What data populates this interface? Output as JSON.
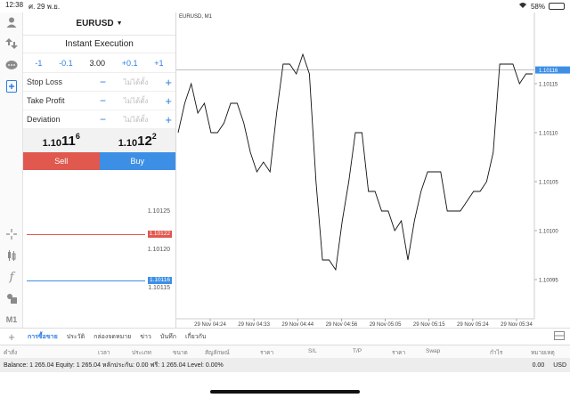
{
  "status": {
    "time": "12:38",
    "date": "ศ. 29 พ.ย.",
    "battery": "58%",
    "battery_level": 0.58
  },
  "colors": {
    "sell": "#e0584e",
    "buy": "#3d8fe6",
    "accent": "#2b7de0",
    "bid_line": "#e0584e",
    "ask_line": "#3d8fe6"
  },
  "rail": {
    "icons": [
      "account-icon",
      "trade-arrows-icon",
      "chat-icon",
      "new-order-icon"
    ],
    "tools": [
      "crosshair-icon",
      "indicators-icon",
      "function-icon",
      "objects-icon"
    ],
    "timeframe": "M1"
  },
  "order": {
    "symbol": "EURUSD",
    "execution": "Instant Execution",
    "volume": {
      "minus1": "-1",
      "minus01": "-0.1",
      "value": "3.00",
      "plus01": "+0.1",
      "plus1": "+1"
    },
    "params": [
      {
        "label": "Stop Loss",
        "value": "ไม่ได้ตั้ง"
      },
      {
        "label": "Take Profit",
        "value": "ไม่ได้ตั้ง"
      },
      {
        "label": "Deviation",
        "value": "ไม่ได้ตั้ง"
      }
    ],
    "bid": {
      "prefix": "1.10",
      "big": "11",
      "sup": "6"
    },
    "ask": {
      "prefix": "1.10",
      "big": "12",
      "sup": "2"
    },
    "sell_label": "Sell",
    "buy_label": "Buy",
    "minus": "−",
    "plus": "+"
  },
  "depth": {
    "labels": [
      "1.10125",
      "1.10120",
      "1.10115"
    ],
    "bid_tag": "1.10122",
    "ask_tag": "1.10116"
  },
  "chart_data": {
    "type": "line",
    "title": "EURUSD, M1",
    "xlabel": "",
    "ylabel": "",
    "x_ticks": [
      "29 Nov 04:24",
      "29 Nov 04:33",
      "29 Nov 04:44",
      "29 Nov 04:56",
      "29 Nov 05:05",
      "29 Nov 05:15",
      "29 Nov 05:24",
      "29 Nov 05:34"
    ],
    "y_ticks": [
      "1.10115",
      "1.10110",
      "1.10105",
      "1.10100",
      "1.10095"
    ],
    "ylim": [
      1.10091,
      1.10121
    ],
    "price_line": {
      "value": 1.101164,
      "label": "1.10116"
    },
    "values": [
      1.1011,
      1.10113,
      1.10115,
      1.10112,
      1.10113,
      1.1011,
      1.1011,
      1.10111,
      1.10113,
      1.10113,
      1.10111,
      1.10108,
      1.10106,
      1.10107,
      1.10106,
      1.10112,
      1.10117,
      1.10117,
      1.10116,
      1.10118,
      1.10116,
      1.10105,
      1.10097,
      1.10097,
      1.10096,
      1.10101,
      1.10105,
      1.1011,
      1.1011,
      1.10104,
      1.10104,
      1.10102,
      1.10102,
      1.101,
      1.10101,
      1.10097,
      1.10101,
      1.10104,
      1.10106,
      1.10106,
      1.10106,
      1.10102,
      1.10102,
      1.10102,
      1.10103,
      1.10104,
      1.10104,
      1.10105,
      1.10108,
      1.10117,
      1.10117,
      1.10117,
      1.10115,
      1.10116,
      1.10116
    ]
  },
  "tabs": [
    "การซื้อขาย",
    "ประวัติ",
    "กล่องจดหมาย",
    "ข่าว",
    "บันทึก",
    "เกี่ยวกับ"
  ],
  "columns": [
    "คำสั่ง",
    "เวลา",
    "ประเภท",
    "ขนาด",
    "สัญลักษณ์",
    "ราคา",
    "S/L",
    "T/P",
    "ราคา",
    "Swap",
    "กำไร",
    "หมายเหตุ"
  ],
  "balance": {
    "text": "Balance: 1 265.04 Equity: 1 265.04 หลักประกัน: 0.00 ฟรี: 1 265.04 Level: 0.00%",
    "profit": "0.00",
    "currency": "USD"
  }
}
